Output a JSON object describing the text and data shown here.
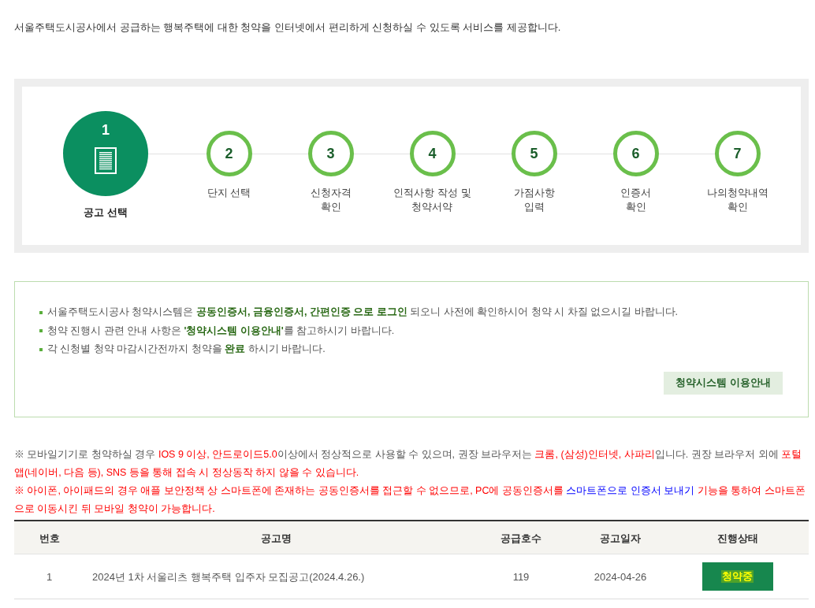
{
  "intro": "서울주택도시공사에서 공급하는 행복주택에 대한 청약을 인터넷에서 편리하게 신청하실 수 있도록 서비스를 제공합니다.",
  "steps": [
    {
      "number": "1",
      "lines": [
        "공고 선택"
      ],
      "selected": true
    },
    {
      "number": "2",
      "lines": [
        "단지 선택"
      ],
      "selected": false
    },
    {
      "number": "3",
      "lines": [
        "신청자격",
        "확인"
      ],
      "selected": false
    },
    {
      "number": "4",
      "lines": [
        "인적사항 작성 및",
        "청약서약"
      ],
      "selected": false
    },
    {
      "number": "5",
      "lines": [
        "가점사항",
        "입력"
      ],
      "selected": false
    },
    {
      "number": "6",
      "lines": [
        "인증서",
        "확인"
      ],
      "selected": false
    },
    {
      "number": "7",
      "lines": [
        "나의청약내역",
        "확인"
      ],
      "selected": false
    }
  ],
  "notices": {
    "items": [
      "서울주택도시공사 청약시스템은 **공동인증서, 금융인증서, 간편인증 으로 로그인** 되오니 사전에 확인하시어 청약 시 차질 없으시길 바랍니다.",
      "청약 진행시 관련 안내 사항은 **'청약시스템 이용안내'**를 참고하시기 바랍니다.",
      "각 신청별 청약 마감시간전까지 청약을 **완료** 하시기 바랍니다."
    ],
    "button": "청약시스템 이용안내"
  },
  "mobile_notes": [
    {
      "segments": [
        {
          "text": "※ 모바일기기로 청약하실 경우 ",
          "kind": "plain"
        },
        {
          "text": "IOS 9 이상, 안드로이드5.0",
          "kind": "warning"
        },
        {
          "text": "이상에서 정상적으로 사용할 수 있으며, 권장 브라우저는 ",
          "kind": "plain"
        },
        {
          "text": "크롬, (삼성)인터넷, 사파리",
          "kind": "warning"
        },
        {
          "text": "입니다. 권장 브라우저 외에 ",
          "kind": "plain"
        },
        {
          "text": "포털앱(네이버, 다음 등), SNS 등을 통해 접속 시 정상동작 하지 않을 수 있습니다.",
          "kind": "warning"
        }
      ]
    },
    {
      "segments": [
        {
          "text": "※ 아이폰, 아이패드의 경우 애플 보안정책 상 스마트폰에 존재하는 공동인증서를 접근할 수 없으므로, PC에 공동인증서를 ",
          "kind": "warning"
        },
        {
          "text": "스마트폰으로 인증서 보내기",
          "kind": "accent"
        },
        {
          "text": " 기능을 통하여 스마트폰으로 이동시킨 뒤 모바일 청약이 가능합니다.",
          "kind": "warning"
        }
      ]
    }
  ],
  "table": {
    "columns": [
      "번호",
      "공고명",
      "공급호수",
      "공고일자",
      "진행상태"
    ],
    "rows": [
      {
        "number": "1",
        "title": "2024년 1차 서울리츠 행복주택 입주자 모집공고(2024.4.26.)",
        "units": "119",
        "date": "2024-04-26",
        "status": "청약중"
      }
    ]
  }
}
